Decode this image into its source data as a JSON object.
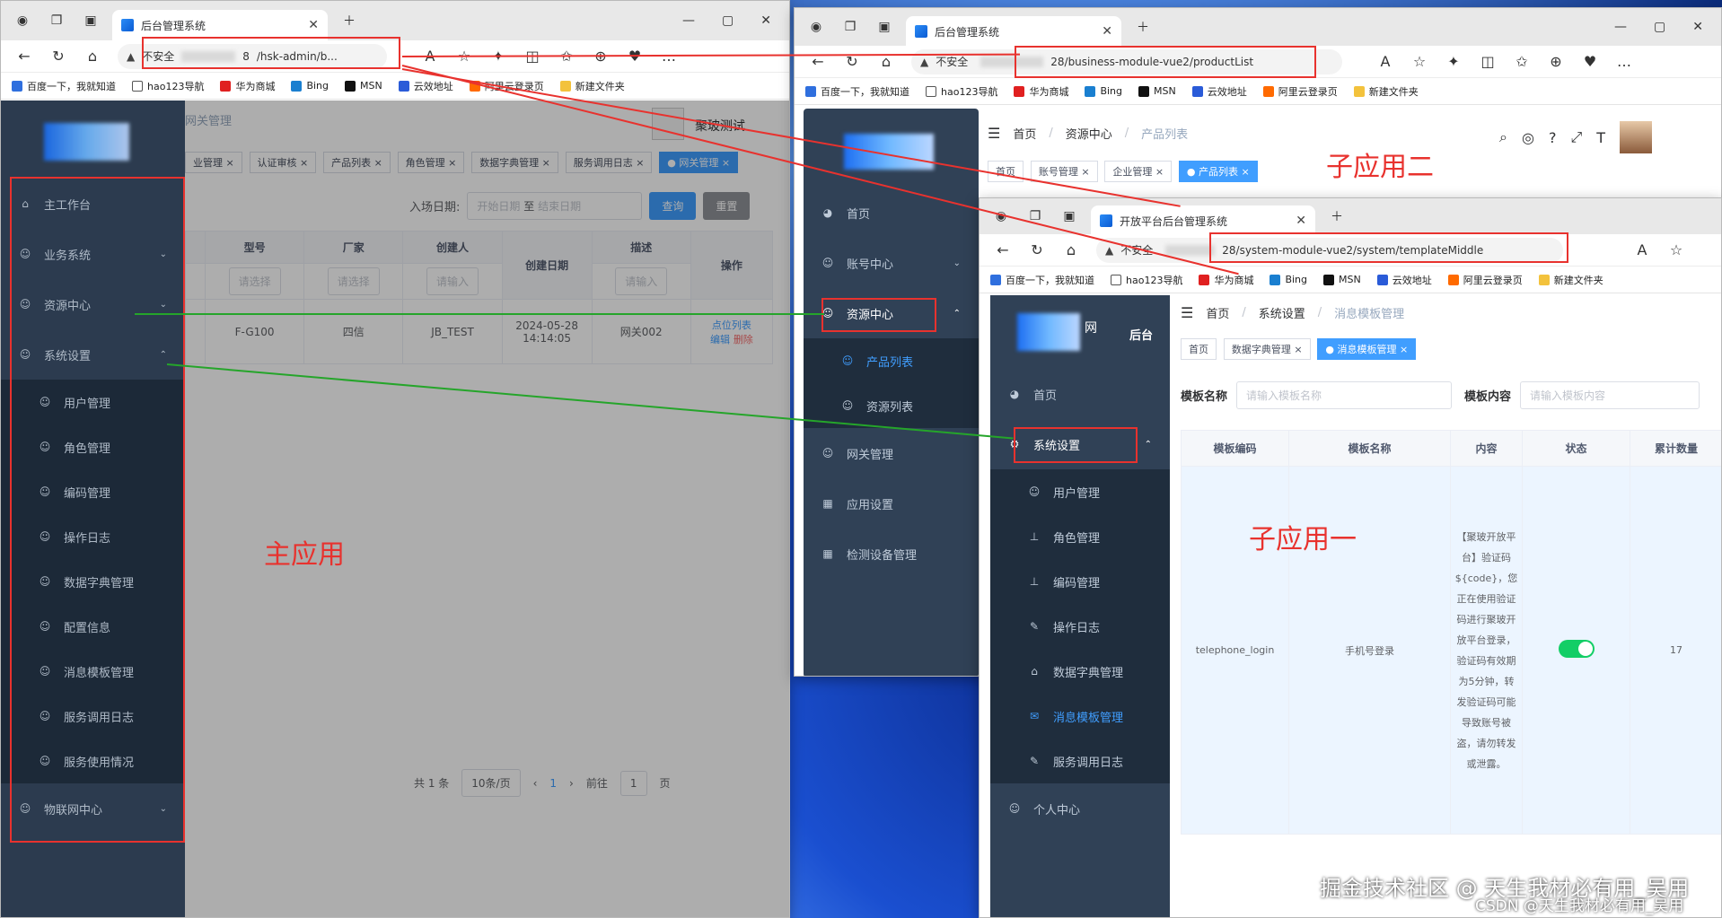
{
  "browser": {
    "tab_title": "后台管理系统",
    "insecure": "不安全",
    "bookmarks": [
      "百度一下，我就知道",
      "hao123导航",
      "华为商城",
      "Bing",
      "MSN",
      "云效地址",
      "阿里云登录页",
      "新建文件夹"
    ]
  },
  "main_app": {
    "url": "/hsk-admin/b...",
    "url_prefix": "8",
    "breadcrumb_last": "网关管理",
    "right_title": "聚玻测试",
    "tags": [
      "业管理",
      "认证审核",
      "产品列表",
      "角色管理",
      "数据字典管理",
      "服务调用日志",
      "网关管理"
    ],
    "date_label": "入场日期:",
    "date_start": "开始日期",
    "date_sep": "至",
    "date_end": "结束日期",
    "query_btn": "查询",
    "reset_btn": "重置",
    "columns": [
      "型号",
      "厂家",
      "创建人",
      "创建日期",
      "描述",
      "操作"
    ],
    "filter_placeholders": [
      "请选择",
      "请选择",
      "请输入",
      "请输入"
    ],
    "row": {
      "model": "F-G100",
      "vendor": "四信",
      "creator": "JB_TEST",
      "date": "2024-05-28 14:14:05",
      "desc": "网关002",
      "op1": "点位列表",
      "op2": "编辑",
      "op3": "删除"
    },
    "pager": {
      "total": "共 1 条",
      "size": "10条/页",
      "page": "1",
      "goto": "前往",
      "goto_val": "1",
      "page_unit": "页"
    },
    "menu": [
      {
        "label": "主工作台",
        "icon": "⌂"
      },
      {
        "label": "业务系统",
        "icon": "☺",
        "chev": "⌄"
      },
      {
        "label": "资源中心",
        "icon": "☺",
        "chev": "⌄"
      },
      {
        "label": "系统设置",
        "icon": "☺",
        "chev": "⌃"
      }
    ],
    "submenu": [
      "用户管理",
      "角色管理",
      "编码管理",
      "操作日志",
      "数据字典管理",
      "配置信息",
      "消息模板管理",
      "服务调用日志",
      "服务使用情况"
    ],
    "menu_last": "物联网中心",
    "label": "主应用"
  },
  "sub_app_two": {
    "url": "28/business-module-vue2/productList",
    "breadcrumb": [
      "首页",
      "资源中心",
      "产品列表"
    ],
    "tags": [
      "首页",
      "账号管理",
      "企业管理",
      "产品列表"
    ],
    "menu": [
      "首页",
      "账号中心",
      "资源中心"
    ],
    "submenu": [
      "产品列表",
      "资源列表"
    ],
    "menu_rest": [
      "网关管理",
      "应用设置",
      "检测设备管理"
    ],
    "label": "子应用二"
  },
  "sub_app_one": {
    "tab_title": "开放平台后台管理系统",
    "url": "28/system-module-vue2/system/templateMiddle",
    "logo_text": "网",
    "logo_suffix": "后台",
    "breadcrumb": [
      "首页",
      "系统设置",
      "消息模板管理"
    ],
    "tags": [
      "首页",
      "数据字典管理",
      "消息模板管理"
    ],
    "filter_name_label": "模板名称",
    "filter_name_ph": "请输入模板名称",
    "filter_content_label": "模板内容",
    "filter_content_ph": "请输入模板内容",
    "columns": [
      "模板编码",
      "模板名称",
      "内容",
      "状态",
      "累计数量"
    ],
    "row": {
      "code": "telephone_login",
      "name": "手机号登录",
      "content": "【聚玻开放平台】验证码${code}，您正在使用验证码进行聚玻开放平台登录，验证码有效期为5分钟，转发验证码可能导致账号被盗，请勿转发或泄露。",
      "count": "17"
    },
    "menu": [
      "首页",
      "系统设置"
    ],
    "submenu": [
      "用户管理",
      "角色管理",
      "编码管理",
      "操作日志",
      "数据字典管理",
      "消息模板管理",
      "服务调用日志"
    ],
    "menu_last": "个人中心",
    "label": "子应用一"
  },
  "watermark": {
    "line1": "掘金技术社区 @ 天生我材必有用_吴用",
    "line2": "CSDN @天生我材必有用_吴用"
  },
  "colors": {
    "sidebar": "#304156",
    "submenu": "#1f2d3d",
    "accent": "#409eff",
    "red": "#e8322e",
    "green": "#25a52a"
  }
}
